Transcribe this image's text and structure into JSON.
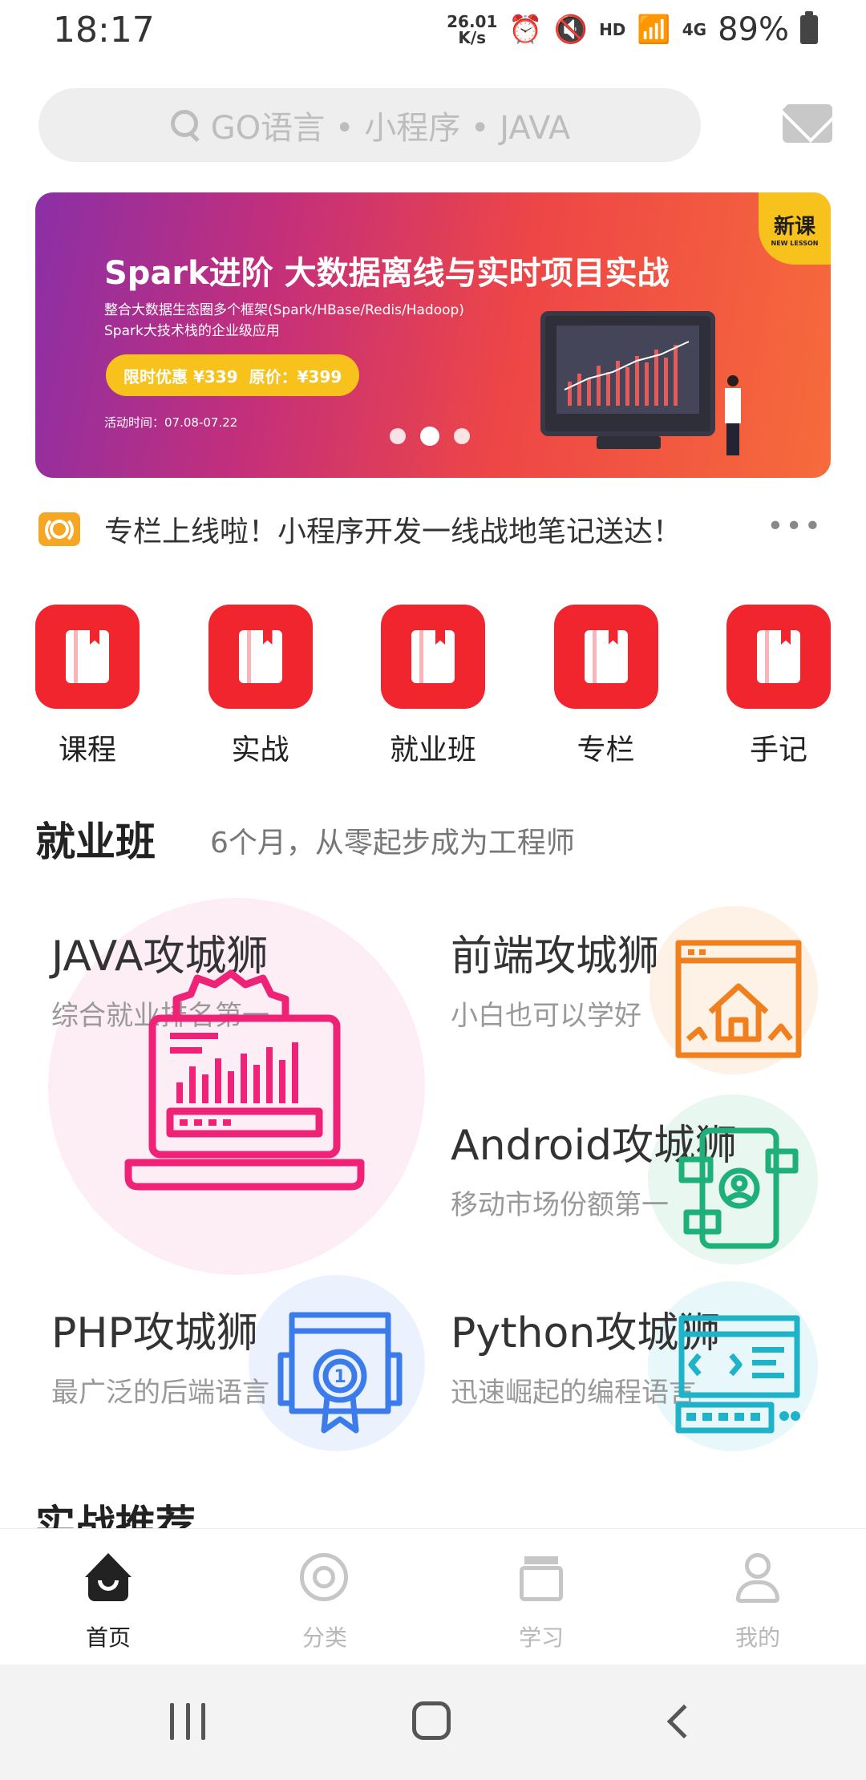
{
  "status_bar": {
    "time": "18:17",
    "net_speed_value": "26.01",
    "net_speed_unit": "K/s",
    "hd_label": "HD",
    "net_type": "4G",
    "battery": "89%"
  },
  "search": {
    "placeholder": "GO语言 • 小程序 • JAVA"
  },
  "banner": {
    "title": "Spark进阶 大数据离线与实时项目实战",
    "subtitle_line1": "整合大数据生态圈多个框架(Spark/HBase/Redis/Hadoop)",
    "subtitle_line2": "Spark大技术栈的企业级应用",
    "promo_label": "限时优惠 ¥339",
    "original_price": "原价：¥399",
    "date": "活动时间：07.08-07.22",
    "badge_title": "新课",
    "badge_sub": "NEW LESSON",
    "slide_count": 3,
    "active_slide": 2
  },
  "notice": {
    "text": "专栏上线啦！小程序开发一线战地笔记送达！",
    "more": "•••"
  },
  "categories": [
    {
      "label": "课程"
    },
    {
      "label": "实战"
    },
    {
      "label": "就业班"
    },
    {
      "label": "专栏"
    },
    {
      "label": "手记"
    }
  ],
  "jobs_section": {
    "title": "就业班",
    "subtitle": "6个月，从零起步成为工程师",
    "cards": [
      {
        "title": "JAVA攻城狮",
        "desc": "综合就业排名第一",
        "color": "#ee2378"
      },
      {
        "title": "前端攻城狮",
        "desc": "小白也可以学好",
        "color": "#f07f1e"
      },
      {
        "title": "Android攻城狮",
        "desc": "移动市场份额第一",
        "color": "#1fb07a"
      },
      {
        "title": "PHP攻城狮",
        "desc": "最广泛的后端语言",
        "color": "#3c7bea"
      },
      {
        "title": "Python攻城狮",
        "desc": "迅速崛起的编程语言",
        "color": "#1fb3c9"
      }
    ]
  },
  "next_section": {
    "title": "实战推荐"
  },
  "tabbar": {
    "items": [
      {
        "label": "首页",
        "active": true
      },
      {
        "label": "分类",
        "active": false
      },
      {
        "label": "学习",
        "active": false
      },
      {
        "label": "我的",
        "active": false
      }
    ]
  }
}
